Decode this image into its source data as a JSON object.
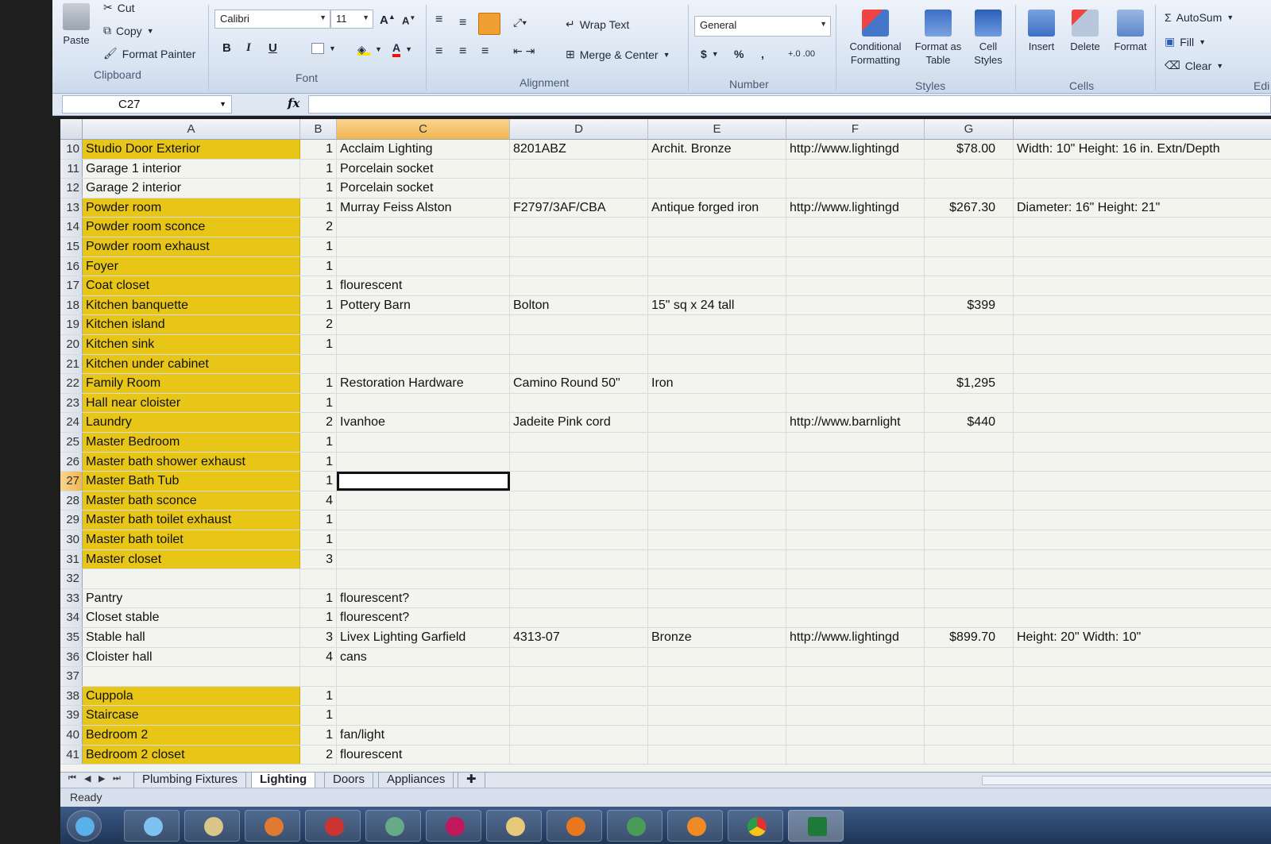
{
  "ribbon": {
    "clipboard": {
      "paste": "Paste",
      "cut": "Cut",
      "copy": "Copy",
      "format_painter": "Format Painter",
      "group": "Clipboard"
    },
    "font": {
      "name": "Calibri",
      "size": "11",
      "group": "Font",
      "bold": "B",
      "italic": "I",
      "underline": "U"
    },
    "alignment": {
      "wrap_text": "Wrap Text",
      "merge_center": "Merge & Center",
      "group": "Alignment"
    },
    "number": {
      "format": "General",
      "currency": "$",
      "percent": "%",
      "comma": ",",
      "group": "Number"
    },
    "styles": {
      "conditional": "Conditional Formatting",
      "format_table": "Format as Table",
      "cell_styles": "Cell Styles",
      "group": "Styles"
    },
    "cells": {
      "insert": "Insert",
      "delete": "Delete",
      "format": "Format",
      "group": "Cells"
    },
    "editing": {
      "autosum": "AutoSum",
      "fill": "Fill",
      "clear": "Clear",
      "group": "Edi"
    }
  },
  "formula_bar": {
    "name_box": "C27",
    "fx": "fx",
    "content": ""
  },
  "columns": [
    "A",
    "B",
    "C",
    "D",
    "E",
    "F",
    "G"
  ],
  "selected_column": "C",
  "selected_row": "27",
  "rows": [
    {
      "n": "10",
      "a": "Studio Door Exterior",
      "hl": true,
      "b": "1",
      "c": "Acclaim Lighting",
      "d": "8201ABZ",
      "e": "Archit. Bronze",
      "f": "http://www.lightingd",
      "g": "$78.00",
      "h": "Width: 10\" Height: 16 in. Extn/Depth"
    },
    {
      "n": "11",
      "a": "Garage 1 interior",
      "hl": false,
      "b": "1",
      "c": "Porcelain socket",
      "d": "",
      "e": "",
      "f": "",
      "g": "",
      "h": ""
    },
    {
      "n": "12",
      "a": "Garage 2 interior",
      "hl": false,
      "b": "1",
      "c": "Porcelain socket",
      "d": "",
      "e": "",
      "f": "",
      "g": "",
      "h": ""
    },
    {
      "n": "13",
      "a": "Powder room",
      "hl": true,
      "b": "1",
      "c": "Murray Feiss Alston",
      "d": "F2797/3AF/CBA",
      "e": "Antique forged iron",
      "f": "http://www.lightingd",
      "g": "$267.30",
      "h": "Diameter: 16\" Height: 21\""
    },
    {
      "n": "14",
      "a": "Powder room sconce",
      "hl": true,
      "b": "2",
      "c": "",
      "d": "",
      "e": "",
      "f": "",
      "g": "",
      "h": ""
    },
    {
      "n": "15",
      "a": "Powder room exhaust",
      "hl": true,
      "b": "1",
      "c": "",
      "d": "",
      "e": "",
      "f": "",
      "g": "",
      "h": ""
    },
    {
      "n": "16",
      "a": "Foyer",
      "hl": true,
      "b": "1",
      "c": "",
      "d": "",
      "e": "",
      "f": "",
      "g": "",
      "h": ""
    },
    {
      "n": "17",
      "a": "Coat closet",
      "hl": true,
      "b": "1",
      "c": "flourescent",
      "d": "",
      "e": "",
      "f": "",
      "g": "",
      "h": ""
    },
    {
      "n": "18",
      "a": "Kitchen banquette",
      "hl": true,
      "b": "1",
      "c": "Pottery Barn",
      "d": "Bolton",
      "e": "15\" sq x 24 tall",
      "f": "",
      "g": "$399",
      "h": ""
    },
    {
      "n": "19",
      "a": "Kitchen island",
      "hl": true,
      "b": "2",
      "c": "",
      "d": "",
      "e": "",
      "f": "",
      "g": "",
      "h": ""
    },
    {
      "n": "20",
      "a": "Kitchen sink",
      "hl": true,
      "b": "1",
      "c": "",
      "d": "",
      "e": "",
      "f": "",
      "g": "",
      "h": ""
    },
    {
      "n": "21",
      "a": "Kitchen under cabinet",
      "hl": true,
      "b": "",
      "c": "",
      "d": "",
      "e": "",
      "f": "",
      "g": "",
      "h": ""
    },
    {
      "n": "22",
      "a": "Family Room",
      "hl": true,
      "b": "1",
      "c": "Restoration Hardware",
      "d": "Camino Round 50\"",
      "e": "Iron",
      "f": "",
      "g": "$1,295",
      "h": ""
    },
    {
      "n": "23",
      "a": "Hall near cloister",
      "hl": true,
      "b": "1",
      "c": "",
      "d": "",
      "e": "",
      "f": "",
      "g": "",
      "h": ""
    },
    {
      "n": "24",
      "a": "Laundry",
      "hl": true,
      "b": "2",
      "c": "Ivanhoe",
      "d": "Jadeite Pink cord",
      "e": "",
      "f": "http://www.barnlight",
      "g": "$440",
      "h": ""
    },
    {
      "n": "25",
      "a": "Master Bedroom",
      "hl": true,
      "b": "1",
      "c": "",
      "d": "",
      "e": "",
      "f": "",
      "g": "",
      "h": ""
    },
    {
      "n": "26",
      "a": "Master bath shower exhaust",
      "hl": true,
      "b": "1",
      "c": "",
      "d": "",
      "e": "",
      "f": "",
      "g": "",
      "h": ""
    },
    {
      "n": "27",
      "a": "Master Bath Tub",
      "hl": true,
      "b": "1",
      "c": "",
      "d": "",
      "e": "",
      "f": "",
      "g": "",
      "h": ""
    },
    {
      "n": "28",
      "a": "Master bath sconce",
      "hl": true,
      "b": "4",
      "c": "",
      "d": "",
      "e": "",
      "f": "",
      "g": "",
      "h": ""
    },
    {
      "n": "29",
      "a": "Master bath toilet exhaust",
      "hl": true,
      "b": "1",
      "c": "",
      "d": "",
      "e": "",
      "f": "",
      "g": "",
      "h": ""
    },
    {
      "n": "30",
      "a": "Master bath toilet",
      "hl": true,
      "b": "1",
      "c": "",
      "d": "",
      "e": "",
      "f": "",
      "g": "",
      "h": ""
    },
    {
      "n": "31",
      "a": "Master closet",
      "hl": true,
      "b": "3",
      "c": "",
      "d": "",
      "e": "",
      "f": "",
      "g": "",
      "h": ""
    },
    {
      "n": "32",
      "a": "",
      "hl": false,
      "b": "",
      "c": "",
      "d": "",
      "e": "",
      "f": "",
      "g": "",
      "h": ""
    },
    {
      "n": "33",
      "a": "Pantry",
      "hl": false,
      "b": "1",
      "c": "flourescent?",
      "d": "",
      "e": "",
      "f": "",
      "g": "",
      "h": ""
    },
    {
      "n": "34",
      "a": "Closet stable",
      "hl": false,
      "b": "1",
      "c": "flourescent?",
      "d": "",
      "e": "",
      "f": "",
      "g": "",
      "h": ""
    },
    {
      "n": "35",
      "a": "Stable hall",
      "hl": false,
      "b": "3",
      "c": "Livex Lighting Garfield",
      "d": "4313-07",
      "e": "Bronze",
      "f": "http://www.lightingd",
      "g": "$899.70",
      "h": "Height: 20\" Width: 10\""
    },
    {
      "n": "36",
      "a": "Cloister hall",
      "hl": false,
      "b": "4",
      "c": "cans",
      "d": "",
      "e": "",
      "f": "",
      "g": "",
      "h": ""
    },
    {
      "n": "37",
      "a": "",
      "hl": false,
      "b": "",
      "c": "",
      "d": "",
      "e": "",
      "f": "",
      "g": "",
      "h": ""
    },
    {
      "n": "38",
      "a": "Cuppola",
      "hl": true,
      "b": "1",
      "c": "",
      "d": "",
      "e": "",
      "f": "",
      "g": "",
      "h": ""
    },
    {
      "n": "39",
      "a": "Staircase",
      "hl": true,
      "b": "1",
      "c": "",
      "d": "",
      "e": "",
      "f": "",
      "g": "",
      "h": ""
    },
    {
      "n": "40",
      "a": "Bedroom 2",
      "hl": true,
      "b": "1",
      "c": "fan/light",
      "d": "",
      "e": "",
      "f": "",
      "g": "",
      "h": ""
    },
    {
      "n": "41",
      "a": "Bedroom 2 closet",
      "hl": true,
      "b": "2",
      "c": "flourescent",
      "d": "",
      "e": "",
      "f": "",
      "g": "",
      "h": ""
    }
  ],
  "sheet_tabs": [
    "Plumbing Fixtures",
    "Lighting",
    "Doors",
    "Appliances"
  ],
  "active_tab": "Lighting",
  "status": "Ready",
  "colors": {
    "highlight": "#e8c617",
    "selection_header": "#f0b550",
    "ribbon": "#d9e4f2"
  }
}
